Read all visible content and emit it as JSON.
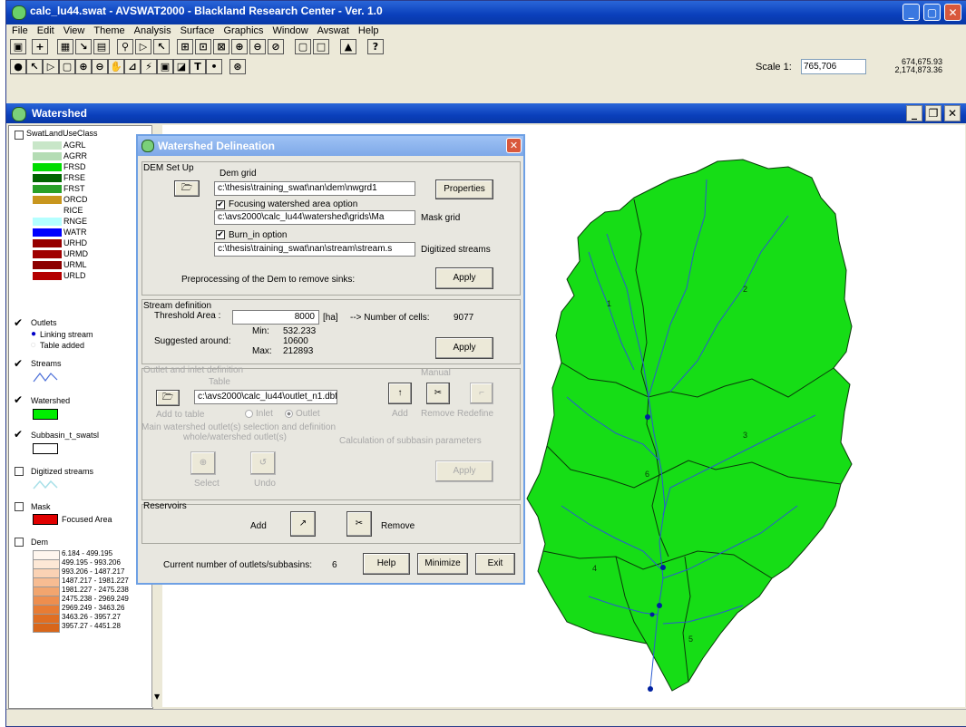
{
  "window": {
    "title": "calc_lu44.swat - AVSWAT2000 - Blackland Research Center - Ver. 1.0"
  },
  "menu": [
    "File",
    "Edit",
    "View",
    "Theme",
    "Analysis",
    "Surface",
    "Graphics",
    "Window",
    "Avswat",
    "Help"
  ],
  "toolbar": {
    "scale_label": "Scale 1:",
    "scale_value": "765,706",
    "coord_x": "674,675.93",
    "coord_y": "2,174,873.36"
  },
  "view": {
    "title": "Watershed"
  },
  "toc": {
    "landuse_layer": "SwatLandUseClass",
    "landuse_classes": [
      {
        "code": "AGRL",
        "color": "#c8e6c8"
      },
      {
        "code": "AGRR",
        "color": "#b4dcb4"
      },
      {
        "code": "FRSD",
        "color": "#00dc00"
      },
      {
        "code": "FRSE",
        "color": "#006400"
      },
      {
        "code": "FRST",
        "color": "#28a028"
      },
      {
        "code": "ORCD",
        "color": "#c8961e"
      },
      {
        "code": "RICE",
        "color": "#ffffff"
      },
      {
        "code": "RNGE",
        "color": "#b4ffff"
      },
      {
        "code": "WATR",
        "color": "#0000ff"
      },
      {
        "code": "URHD",
        "color": "#960000"
      },
      {
        "code": "URMD",
        "color": "#a00000"
      },
      {
        "code": "URML",
        "color": "#8c0000"
      },
      {
        "code": "URLD",
        "color": "#b40000"
      }
    ],
    "outlets_layer": "Outlets",
    "outlets_items": [
      "Linking stream",
      "Table added"
    ],
    "streams_layer": "Streams",
    "watershed_layer": "Watershed",
    "subbasin_layer": "Subbasin_t_swatsl",
    "digitized_layer": "Digitized streams",
    "mask_layer": "Mask",
    "mask_item": "Focused Area",
    "dem_layer": "Dem",
    "dem_classes": [
      {
        "range": "6.184 - 499.195",
        "color": "#fff6ee"
      },
      {
        "range": "499.195 - 993.206",
        "color": "#fde8d6"
      },
      {
        "range": "993.206 - 1487.217",
        "color": "#fad2b4"
      },
      {
        "range": "1487.217 - 1981.227",
        "color": "#f7bc92"
      },
      {
        "range": "1981.227 - 2475.238",
        "color": "#f2a56e"
      },
      {
        "range": "2475.238 - 2969.249",
        "color": "#ee8e4e"
      },
      {
        "range": "2969.249 - 3463.26",
        "color": "#e87c34"
      },
      {
        "range": "3463.26 - 3957.27",
        "color": "#e06e22"
      },
      {
        "range": "3957.27 - 4451.28",
        "color": "#d8661a"
      }
    ]
  },
  "dialog": {
    "title": "Watershed Delineation",
    "dem_setup": "DEM Set Up",
    "dem_grid_label": "Dem grid",
    "dem_grid_path": "c:\\thesis\\training_swat\\nan\\dem\\nwgrd1",
    "properties_button": "Properties",
    "focusing_label": "Focusing watershed area option",
    "mask_path": "c:\\avs2000\\calc_lu44\\watershed\\grids\\Ma",
    "mask_grid_label": "Mask grid",
    "burnin_label": "Burn_in option",
    "stream_path": "c:\\thesis\\training_swat\\nan\\stream\\stream.s",
    "digitized_label": "Digitized streams",
    "preprocess_label": "Preprocessing of the Dem to remove sinks:",
    "apply": "Apply",
    "stream_def": "Stream definition",
    "threshold_label": "Threshold Area :",
    "threshold_value": "8000",
    "ha_unit": "[ha]",
    "cells_label": "--> Number of cells:",
    "cells_value": "9077",
    "min_label": "Min:",
    "min_value": "532.233",
    "suggested_label": "Suggested around:",
    "suggested_value": "10600",
    "max_label": "Max:",
    "max_value": "212893",
    "outlet_def": "Outlet and inlet definition",
    "table_label": "Table",
    "manual_label": "Manual",
    "outlet_path": "c:\\avs2000\\calc_lu44\\outlet_n1.dbf",
    "add_to_table": "Add to table",
    "inlet_label": "Inlet",
    "outlet_label": "Outlet",
    "add_label": "Add",
    "remove_redefine": "Remove Redefine",
    "main_outlet_label": "Main watershed outlet(s) selection and definition",
    "whole_outlet_label": "whole/watershed outlet(s)",
    "calc_sub_label": "Calculation of subbasin parameters",
    "select_label": "Select",
    "undo_label": "Undo",
    "reservoirs": "Reservoirs",
    "res_add": "Add",
    "res_remove": "Remove",
    "current_label": "Current number of outlets/subbasins:",
    "current_value": "6",
    "help": "Help",
    "minimize": "Minimize",
    "exit": "Exit"
  },
  "map": {
    "subbasin_ids": [
      "1",
      "2",
      "3",
      "4",
      "5",
      "6"
    ]
  }
}
